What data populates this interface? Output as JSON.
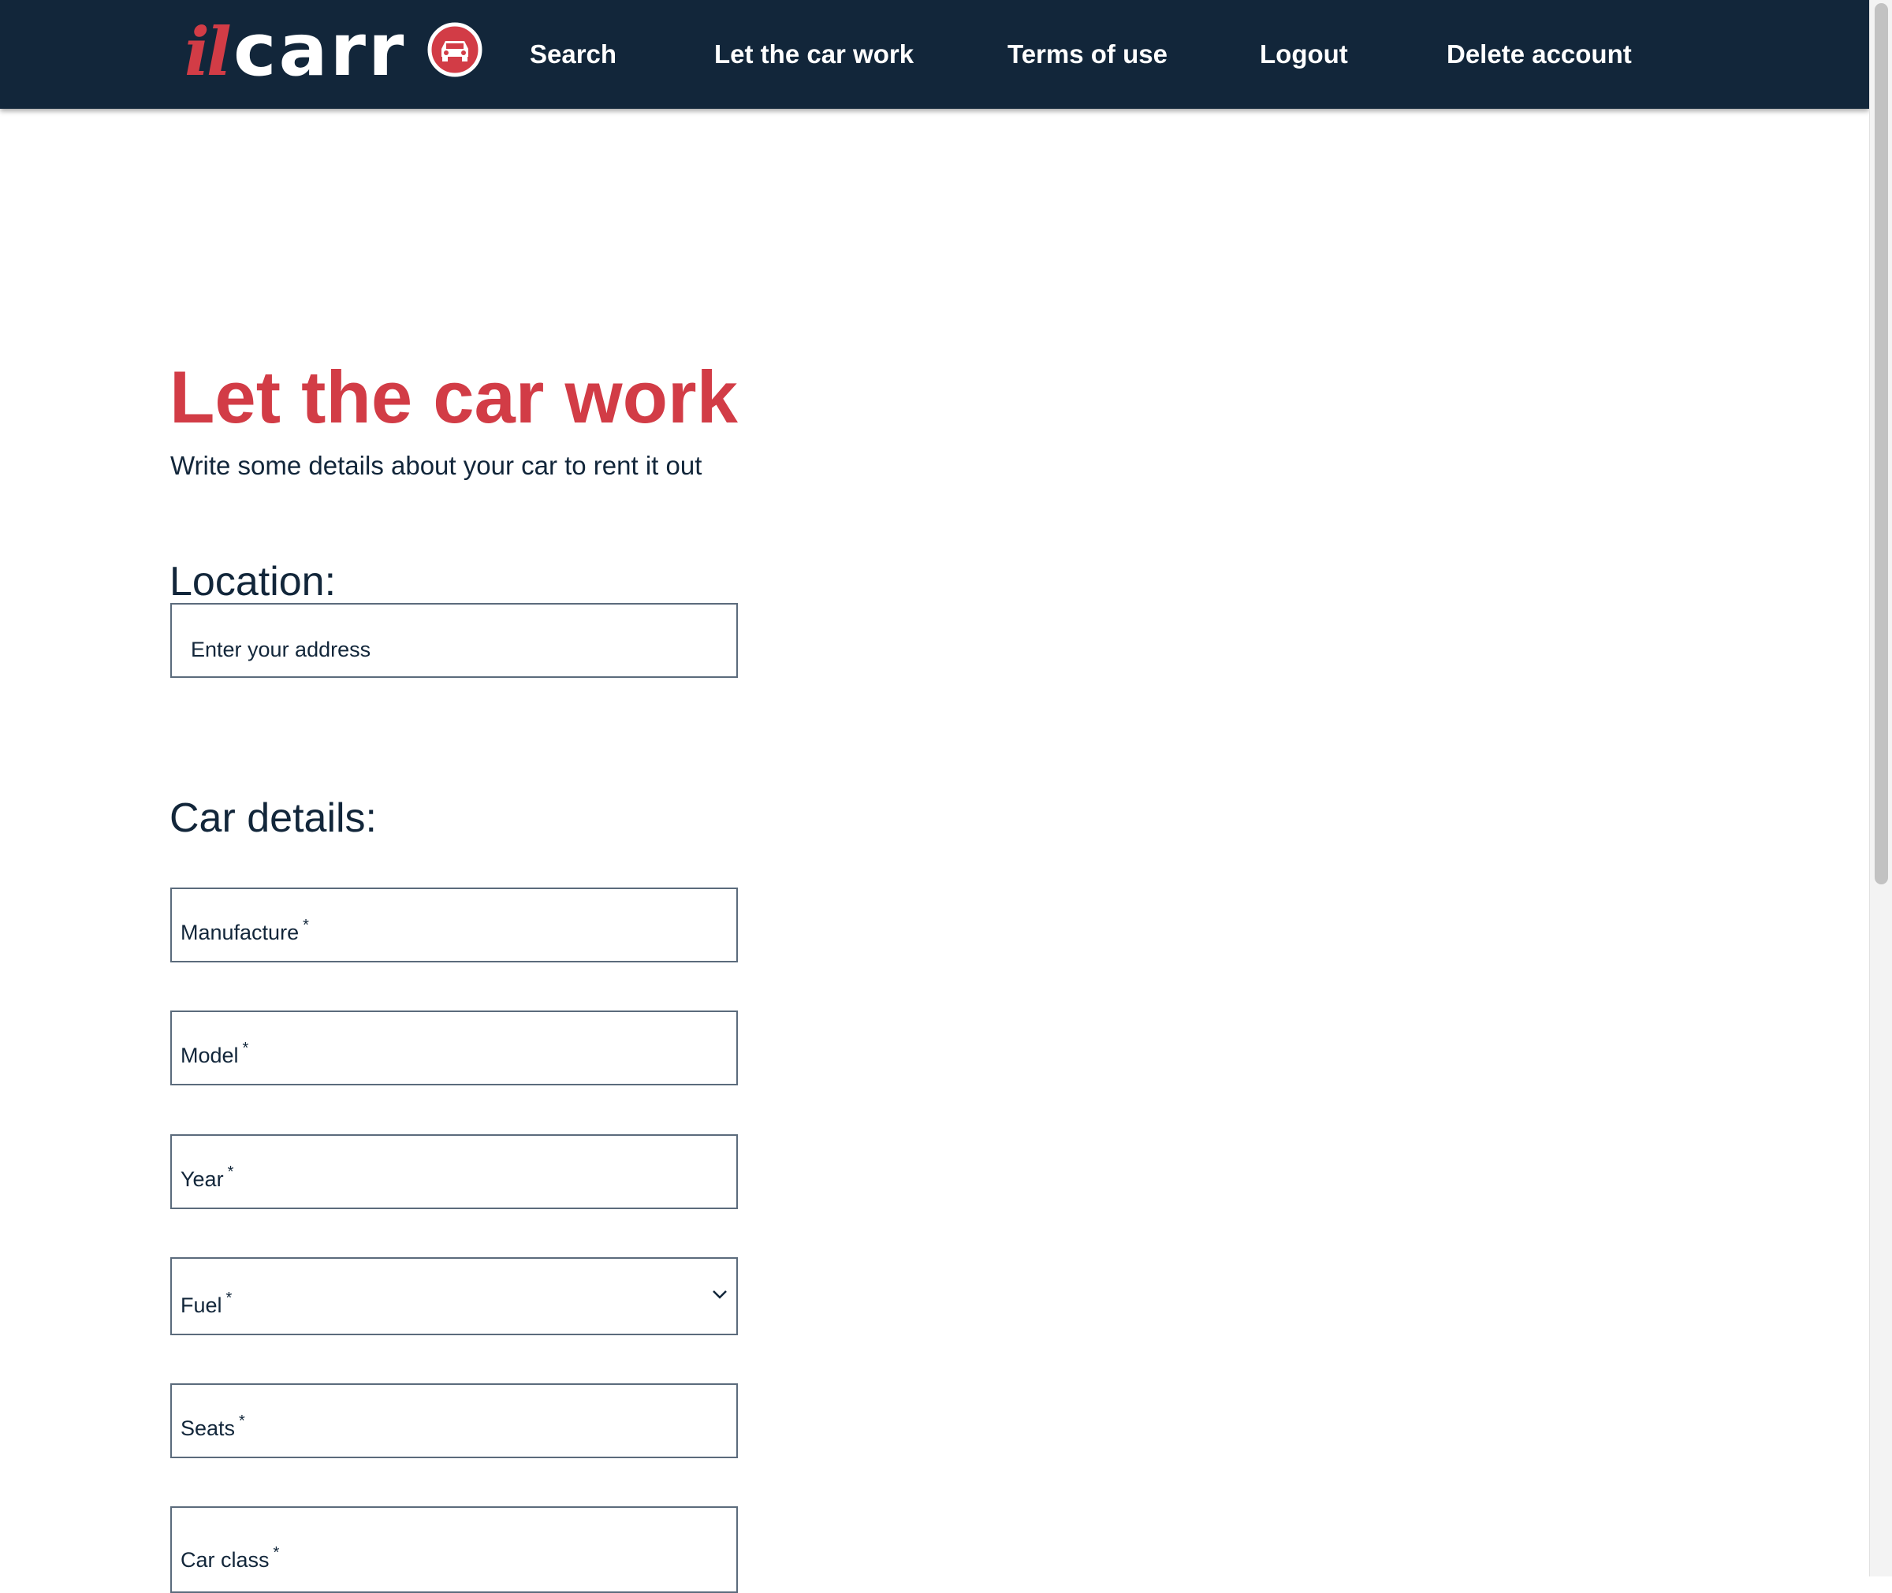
{
  "header": {
    "logo": {
      "text_il": "il",
      "text_carr": "carr",
      "icon": "car-icon",
      "accent_color": "#d23c46"
    },
    "nav": {
      "search": "Search",
      "let_the_car_work": "Let the car work",
      "terms_of_use": "Terms of use",
      "logout": "Logout",
      "delete_account": "Delete account"
    },
    "background_color": "#12263a"
  },
  "main": {
    "title": "Let the car work",
    "subtitle": "Write some details about your car to rent it out",
    "location": {
      "heading": "Location:",
      "address_placeholder": "Enter your address"
    },
    "car_details": {
      "heading": "Car details:",
      "required_mark": "*",
      "fields": {
        "manufacture": "Manufacture",
        "model": "Model",
        "year": "Year",
        "fuel": "Fuel",
        "seats": "Seats",
        "car_class": "Car class"
      },
      "fuel_dropdown_icon": "chevron-down-icon"
    }
  }
}
